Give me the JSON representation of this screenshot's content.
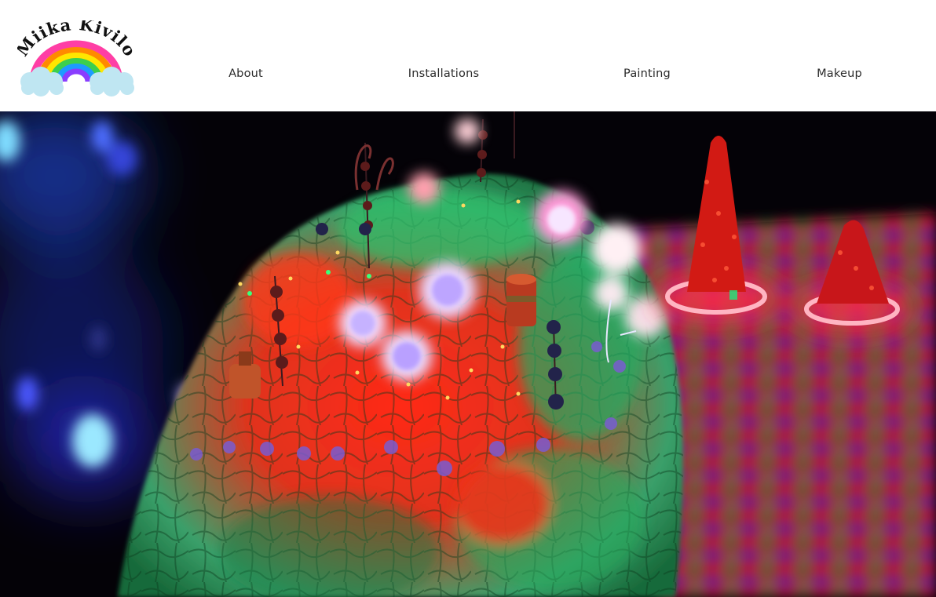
{
  "site": {
    "logo_text": "Miika Kivilo"
  },
  "nav": {
    "items": [
      {
        "label": "About"
      },
      {
        "label": "Installations"
      },
      {
        "label": "Painting"
      },
      {
        "label": "Makeup"
      }
    ]
  },
  "hero": {
    "description": "Glowing UV-lit installation of a textured mound with pom-poms, beaded stems and small red cone trees"
  },
  "colors": {
    "header_bg": "#ffffff",
    "nav_text": "#2b2b2b",
    "hero_bg": "#050208"
  }
}
